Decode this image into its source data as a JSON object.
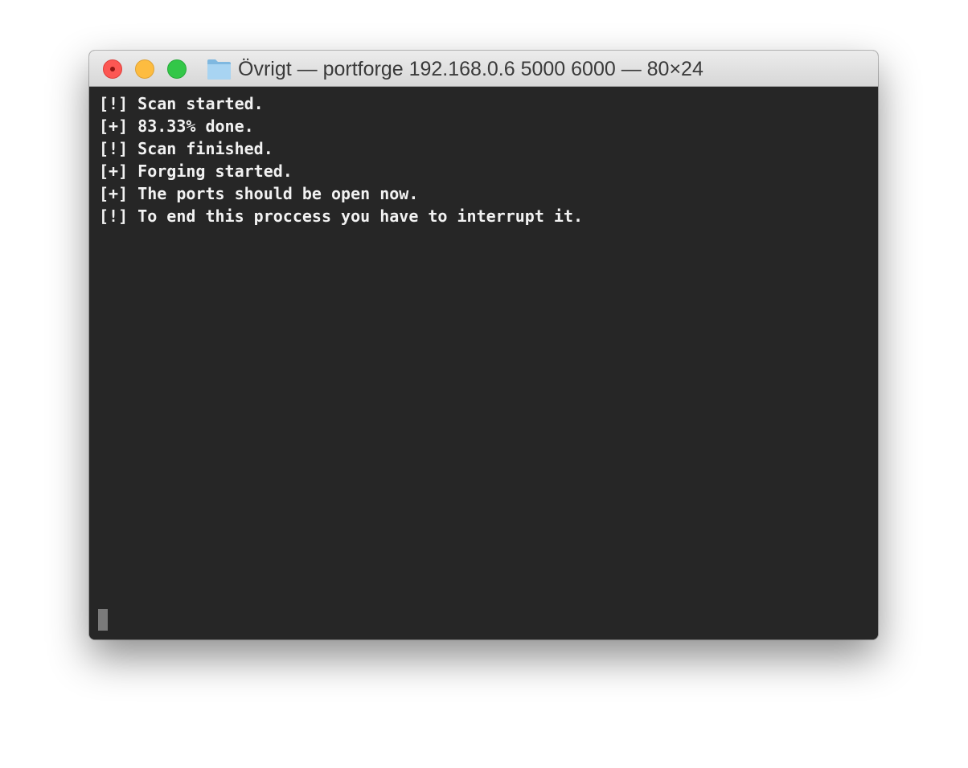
{
  "window": {
    "title": "Övrigt — portforge 192.168.0.6 5000 6000 — 80×24",
    "folder_icon": "folder-icon",
    "controls": {
      "close": "close-button",
      "minimize": "minimize-button",
      "zoom": "zoom-button"
    },
    "colors": {
      "close": "#fc5753",
      "minimize": "#fdbc40",
      "zoom": "#33c748",
      "terminal_bg": "#262626",
      "terminal_text": "#f2f2f2"
    }
  },
  "terminal": {
    "lines": [
      "[!] Scan started.",
      "[+] 83.33% done.",
      "[!] Scan finished.",
      "[+] Forging started.",
      "[+] The ports should be open now.",
      "[!] To end this proccess you have to interrupt it."
    ]
  }
}
